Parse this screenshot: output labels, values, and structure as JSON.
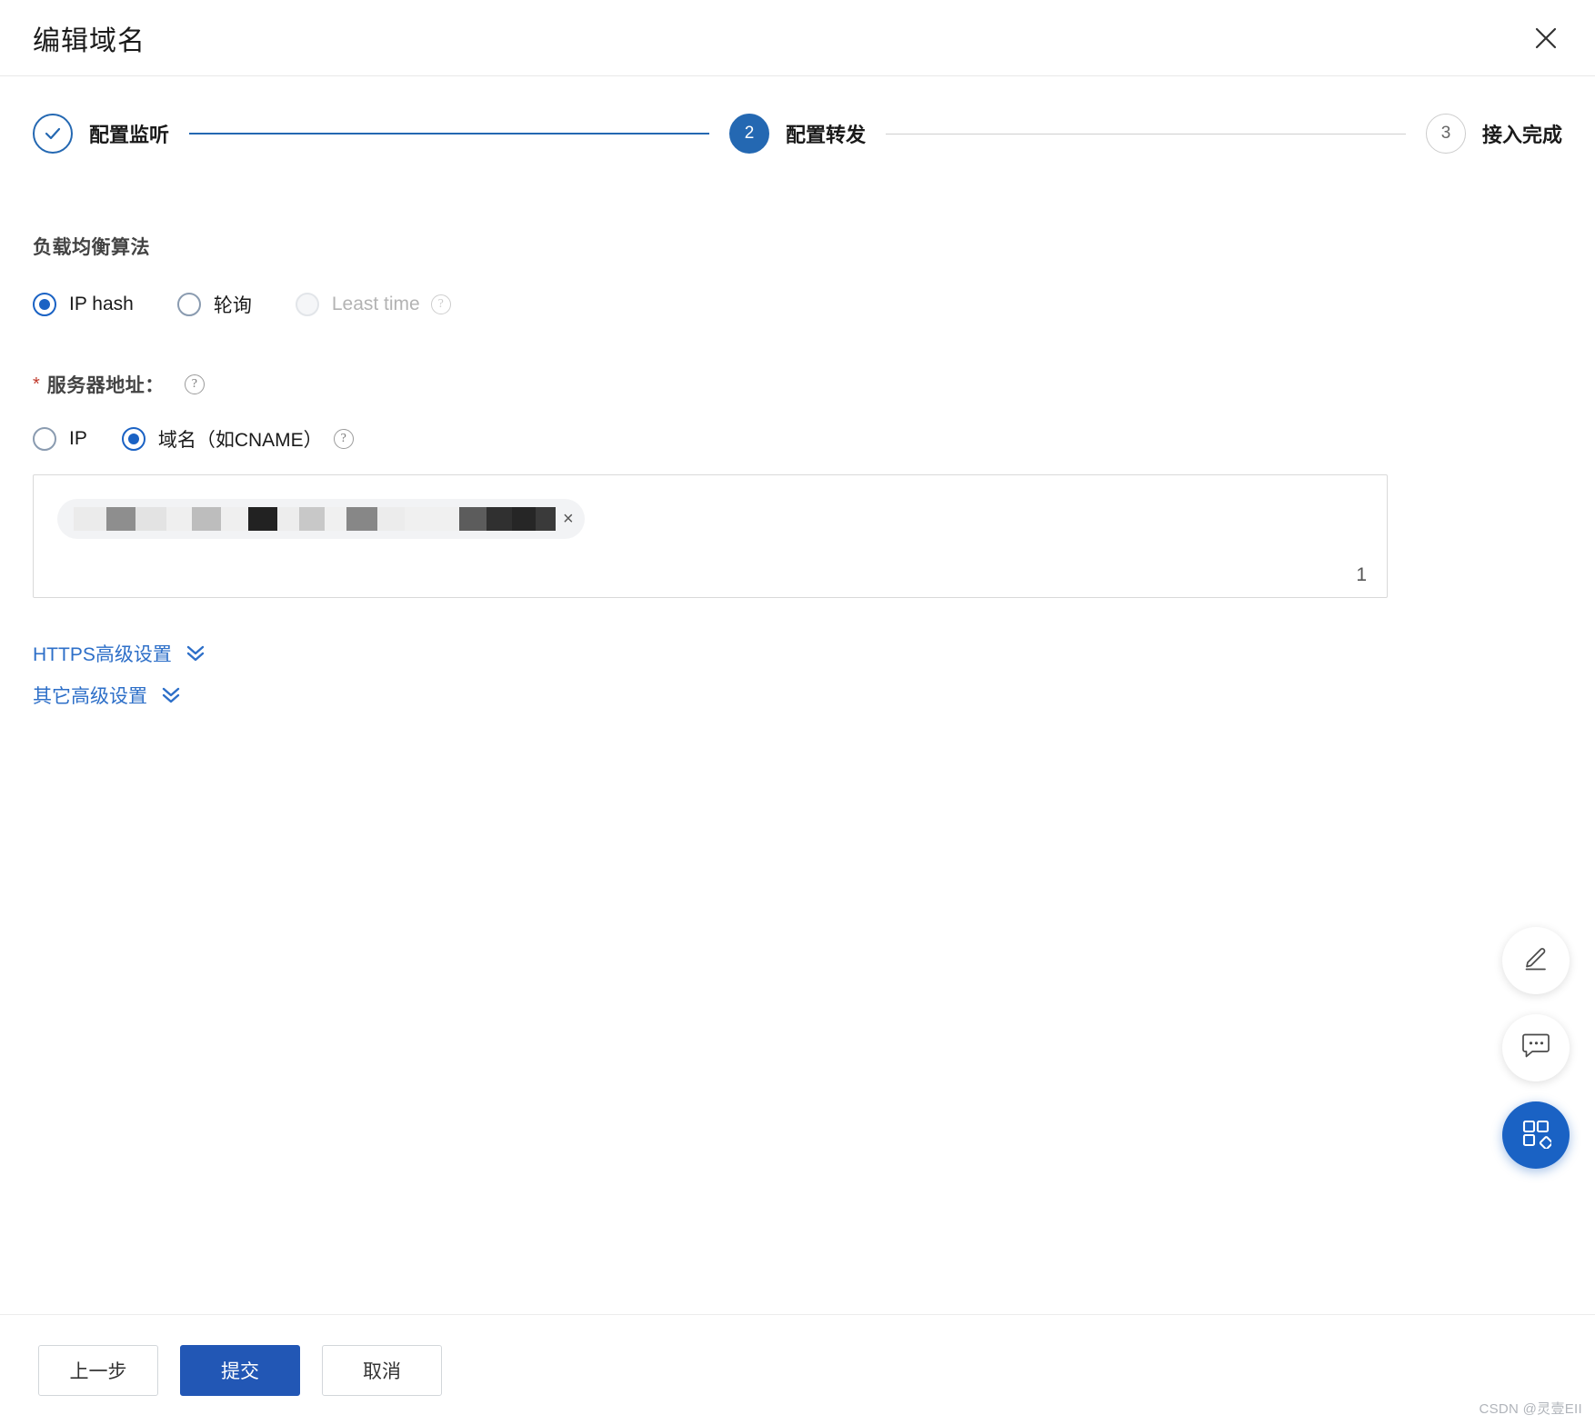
{
  "dialog": {
    "title": "编辑域名",
    "close_icon": "close-icon"
  },
  "stepper": {
    "steps": [
      {
        "num": "✓",
        "label": "配置监听",
        "state": "done"
      },
      {
        "num": "2",
        "label": "配置转发",
        "state": "active"
      },
      {
        "num": "3",
        "label": "接入完成",
        "state": "todo"
      }
    ]
  },
  "algorithm": {
    "section_title": "负载均衡算法",
    "options": [
      {
        "label": "IP hash",
        "checked": true,
        "disabled": false,
        "help": false
      },
      {
        "label": "轮询",
        "checked": false,
        "disabled": false,
        "help": false
      },
      {
        "label": "Least time",
        "checked": false,
        "disabled": true,
        "help": true
      }
    ]
  },
  "server_address": {
    "required_mark": "*",
    "label": "服务器地址：",
    "help_icon": "question-circle-icon",
    "types": [
      {
        "label": "IP",
        "checked": false,
        "help": false
      },
      {
        "label": "域名（如CNAME）",
        "checked": true,
        "help": true
      }
    ],
    "tag": {
      "value_masked": "",
      "remove_icon": "×"
    },
    "count": "1"
  },
  "advanced": {
    "links": [
      {
        "label": "HTTPS高级设置",
        "icon": "double-chevron-down-icon"
      },
      {
        "label": "其它高级设置",
        "icon": "double-chevron-down-icon"
      }
    ]
  },
  "float_buttons": [
    {
      "name": "edit-feedback-button",
      "icon": "pencil-icon"
    },
    {
      "name": "chat-support-button",
      "icon": "speech-bubble-icon"
    },
    {
      "name": "app-grid-button",
      "icon": "grid-icon"
    }
  ],
  "footer": {
    "prev_label": "上一步",
    "submit_label": "提交",
    "cancel_label": "取消"
  },
  "watermark": "CSDN @灵壹EII",
  "colors": {
    "accent": "#2468b2",
    "primary_button": "#2257b5",
    "radio_checked": "#1a62c4",
    "link": "#2d6fc8",
    "required": "#c0392b"
  }
}
